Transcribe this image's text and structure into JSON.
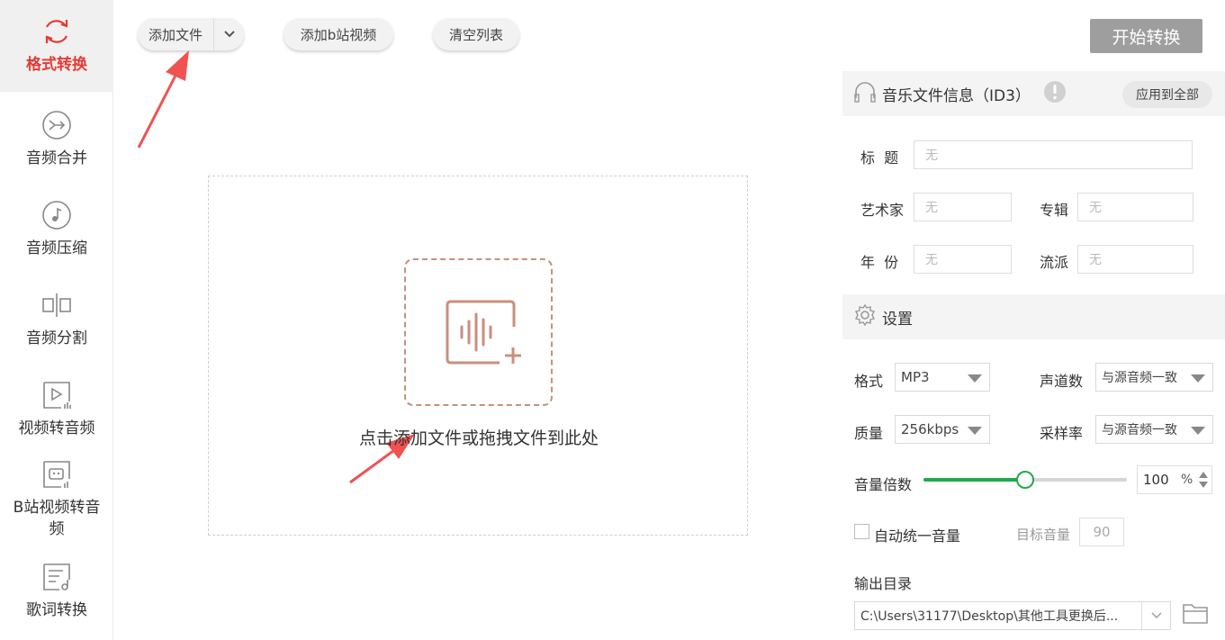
{
  "sidebar": {
    "items": [
      {
        "label": "格式转换",
        "icon": "refresh-icon"
      },
      {
        "label": "音频合并",
        "icon": "merge-icon"
      },
      {
        "label": "音频压缩",
        "icon": "compress-icon"
      },
      {
        "label": "音频分割",
        "icon": "split-icon"
      },
      {
        "label": "视频转音频",
        "icon": "video-to-audio-icon"
      },
      {
        "label": "B站视频转音频",
        "icon": "bilibili-icon"
      },
      {
        "label": "歌词转换",
        "icon": "lyrics-icon"
      }
    ]
  },
  "toolbar": {
    "add_file": "添加文件",
    "add_bilibili": "添加b站视频",
    "clear_list": "清空列表",
    "start": "开始转换"
  },
  "dropzone": {
    "hint": "点击添加文件或拖拽文件到此处"
  },
  "id3": {
    "title": "音乐文件信息（ID3）",
    "apply_all": "应用到全部",
    "fields": {
      "title_label": "标  题",
      "title_value": "无",
      "artist_label": "艺术家",
      "artist_value": "无",
      "album_label": "专辑",
      "album_value": "无",
      "year_label": "年  份",
      "year_value": "无",
      "genre_label": "流派",
      "genre_value": "无"
    }
  },
  "settings": {
    "title": "设置",
    "format_label": "格式",
    "format_value": "MP3",
    "channels_label": "声道数",
    "channels_value": "与源音频一致",
    "quality_label": "质量",
    "quality_value": "256kbps",
    "samplerate_label": "采样率",
    "samplerate_value": "与源音频一致",
    "volume_label": "音量倍数",
    "volume_value": "100",
    "volume_unit": "%",
    "volume_fraction": 0.5,
    "auto_volume_label": "自动统一音量",
    "target_volume_label": "目标音量",
    "target_volume_value": "90",
    "output_label": "输出目录",
    "output_path": "C:\\Users\\31177\\Desktop\\其他工具更换后..."
  },
  "colors": {
    "accent_red": "#e53935",
    "slider_green": "#22a94a",
    "drop_icon": "#c98f7d",
    "start_button": "#9e9e9e"
  }
}
